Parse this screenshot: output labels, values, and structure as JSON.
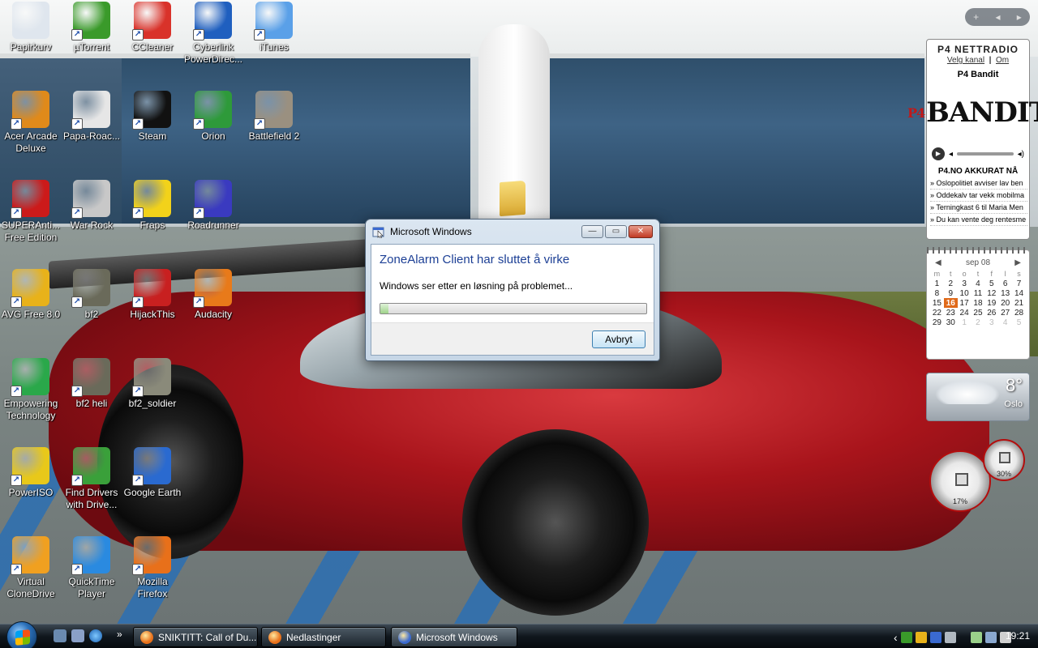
{
  "desktop_icons": [
    {
      "label": "Papirkurv",
      "icon": "recycle-bin-icon",
      "color": "#dfe6ee"
    },
    {
      "label": "µTorrent",
      "icon": "utorrent-icon",
      "color": "#3a9a2a"
    },
    {
      "label": "CCleaner",
      "icon": "ccleaner-icon",
      "color": "#d9322a"
    },
    {
      "label": "Cyberlink PowerDirec...",
      "icon": "powerdirector-icon",
      "color": "#1f5fbf"
    },
    {
      "label": "iTunes",
      "icon": "itunes-icon",
      "color": "#5aa0e8"
    },
    {
      "label": "Acer Arcade Deluxe",
      "icon": "acer-arcade-icon",
      "color": "#e08a1a"
    },
    {
      "label": "Papa-Roac...",
      "icon": "mp3-file-icon",
      "color": "#e6e6e6"
    },
    {
      "label": "Steam",
      "icon": "steam-icon",
      "color": "#111111"
    },
    {
      "label": "Orion",
      "icon": "orion-icon",
      "color": "#2e9a3a"
    },
    {
      "label": "Battlefield 2",
      "icon": "battlefield-icon",
      "color": "#9a9080"
    },
    {
      "label": "SUPERAnti... Free Edition",
      "icon": "superantispyware-icon",
      "color": "#cc1a1a"
    },
    {
      "label": "War Rock",
      "icon": "war-rock-icon",
      "color": "#c8c8c8"
    },
    {
      "label": "Fraps",
      "icon": "fraps-icon",
      "color": "#f2d21a"
    },
    {
      "label": "Roadrunner",
      "icon": "roadrunner-icon",
      "color": "#3a3ac0"
    },
    {
      "label": "AVG Free 8.0",
      "icon": "avg-icon",
      "color": "#e8b21a"
    },
    {
      "label": "bf2",
      "icon": "bf2-icon",
      "color": "#6a6a5a"
    },
    {
      "label": "HijackThis",
      "icon": "hijackthis-icon",
      "color": "#c82020"
    },
    {
      "label": "Audacity",
      "icon": "audacity-icon",
      "color": "#e87a1a"
    },
    {
      "label": "Empowering Technology",
      "icon": "empowering-technology-icon",
      "color": "#2aa84a"
    },
    {
      "label": "bf2 heli",
      "icon": "bf2-heli-icon",
      "color": "#6a6a5a"
    },
    {
      "label": "bf2_soldier",
      "icon": "bf2-soldier-icon",
      "color": "#8a8a7a"
    },
    {
      "label": "PowerISO",
      "icon": "poweriso-icon",
      "color": "#e8c81a"
    },
    {
      "label": "Find Drivers with Drive...",
      "icon": "find-drivers-icon",
      "color": "#3aa03a"
    },
    {
      "label": "Google Earth",
      "icon": "google-earth-icon",
      "color": "#2a6ad0"
    },
    {
      "label": "Virtual CloneDrive",
      "icon": "virtual-clonedrive-icon",
      "color": "#f0a020"
    },
    {
      "label": "QuickTime Player",
      "icon": "quicktime-icon",
      "color": "#2a8ae0"
    },
    {
      "label": "Mozilla Firefox",
      "icon": "firefox-icon",
      "color": "#e8701a"
    }
  ],
  "dialog": {
    "title": "Microsoft Windows",
    "heading": "ZoneAlarm Client har sluttet å virke",
    "message": "Windows ser etter en løsning på problemet...",
    "progress": 0.03,
    "cancel_label": "Avbryt",
    "minimize_glyph": "—",
    "maximize_glyph": "▭",
    "close_glyph": "✕"
  },
  "sidebar": {
    "toolbar": {
      "add": "+",
      "prev": "◂",
      "next": "▸"
    },
    "radio": {
      "title": "P4 NETTRADIO",
      "link_channel": "Velg kanal",
      "separator": "|",
      "link_about": "Om",
      "station": "P4 Bandit",
      "logo_prefix": "P4",
      "logo_text": "BANDIT",
      "news_heading": "P4.NO AKKURAT NÅ",
      "news": [
        "Oslopolitiet avviser lav ben",
        "Oddekalv tar vekk mobilma",
        "Terningkast 6 til Maria Men",
        "Du kan vente deg rentesme"
      ]
    },
    "calendar": {
      "month": "sep 08",
      "prev": "◀",
      "next": "▶",
      "day_names": [
        "m",
        "t",
        "o",
        "t",
        "f",
        "l",
        "s"
      ],
      "weeks": [
        [
          "1",
          "2",
          "3",
          "4",
          "5",
          "6",
          "7"
        ],
        [
          "8",
          "9",
          "10",
          "11",
          "12",
          "13",
          "14"
        ],
        [
          "15",
          "16",
          "17",
          "18",
          "19",
          "20",
          "21"
        ],
        [
          "22",
          "23",
          "24",
          "25",
          "26",
          "27",
          "28"
        ],
        [
          "29",
          "30",
          "1",
          "2",
          "3",
          "4",
          "5"
        ]
      ],
      "today": "16"
    },
    "weather": {
      "temperature": "8°",
      "city": "Oslo"
    },
    "meters": {
      "cpu": "17%",
      "memory": "30%"
    }
  },
  "taskbar": {
    "more": "»",
    "tasks": [
      {
        "label": "SNIKTITT: Call of Du...",
        "icon": "firefox-icon",
        "color": "#e8701a"
      },
      {
        "label": "Nedlastinger",
        "icon": "firefox-icon",
        "color": "#e8701a"
      },
      {
        "label": "Microsoft Windows",
        "icon": "windows-dialog-icon",
        "color": "#3a6ad0"
      }
    ],
    "tray_expand": "‹",
    "clock": "19:21"
  }
}
